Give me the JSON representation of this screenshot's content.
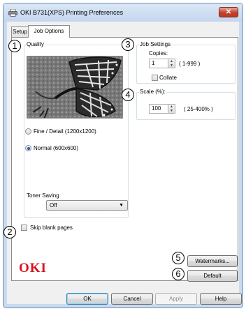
{
  "window": {
    "title": "OKI B731(XPS) Printing Preferences",
    "close_label": "✕"
  },
  "tabs": [
    {
      "label": "Setup"
    },
    {
      "label": "Job Options"
    }
  ],
  "callouts": [
    "1",
    "2",
    "3",
    "4",
    "5",
    "6"
  ],
  "quality": {
    "label": "Quality",
    "options": [
      {
        "label": "Fine / Detail (1200x1200)",
        "checked": false
      },
      {
        "label": "Normal (600x600)",
        "checked": true
      }
    ]
  },
  "toner_saving": {
    "label": "Toner Saving",
    "value": "Off"
  },
  "skip_blank": {
    "label": "Skip blank pages",
    "checked": false
  },
  "job_settings": {
    "label": "Job Settings",
    "copies_label": "Copies:",
    "copies_value": "1",
    "copies_range": "( 1-999 )",
    "collate_label": "Collate",
    "collate_checked": false
  },
  "scale": {
    "label": "Scale (%):",
    "value": "100",
    "range": "( 25-400% )"
  },
  "buttons": {
    "watermarks": "Watermarks...",
    "default": "Default"
  },
  "brand": {
    "logo": "OKI",
    "color": "#d7141b"
  },
  "footer": {
    "ok": "OK",
    "cancel": "Cancel",
    "apply": "Apply",
    "help": "Help"
  }
}
